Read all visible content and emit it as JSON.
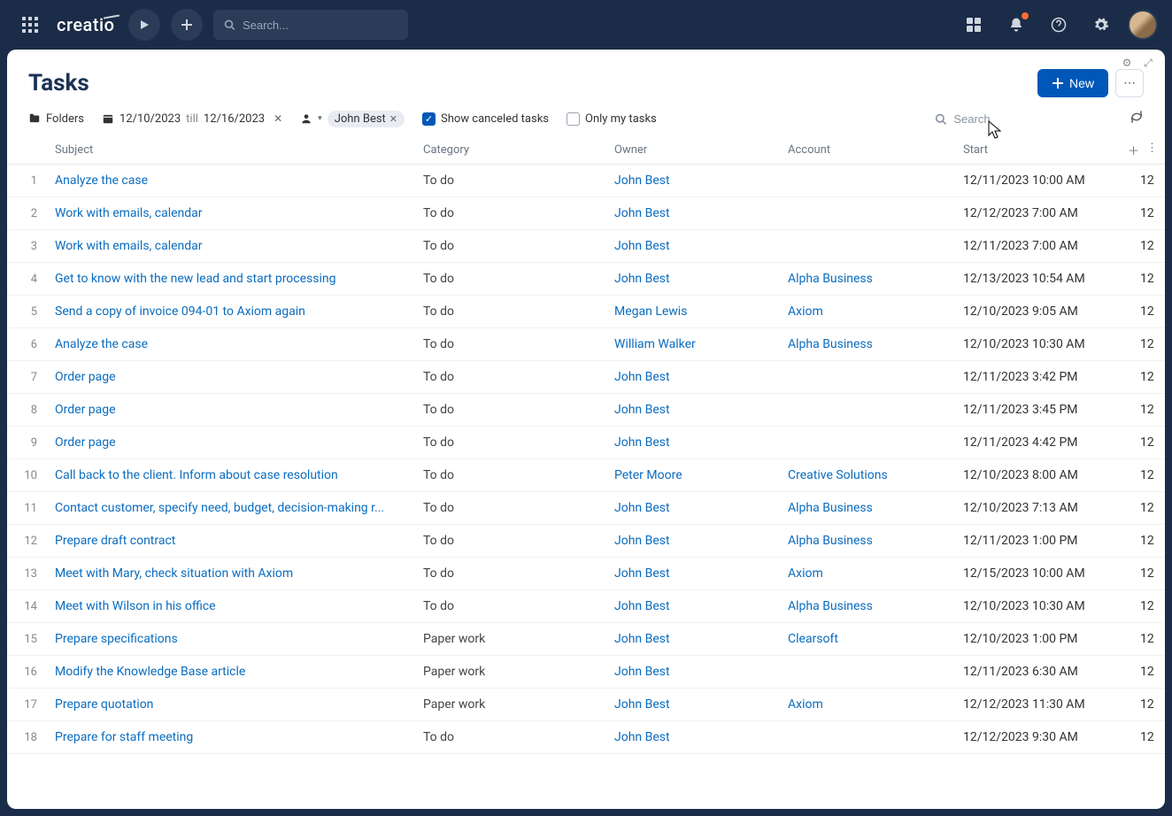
{
  "brand": "creatio",
  "global_search_placeholder": "Search...",
  "page_title": "Tasks",
  "new_button": "New",
  "filters": {
    "folders_label": "Folders",
    "date_from": "12/10/2023",
    "date_till_word": "till",
    "date_to": "12/16/2023",
    "owner_chip": "John Best",
    "show_canceled_label": "Show canceled tasks",
    "show_canceled_checked": true,
    "only_my_label": "Only my tasks",
    "only_my_checked": false,
    "search_placeholder": "Search"
  },
  "columns": {
    "subject": "Subject",
    "category": "Category",
    "owner": "Owner",
    "account": "Account",
    "start": "Start"
  },
  "rows": [
    {
      "n": "1",
      "subject": "Analyze the case",
      "category": "To do",
      "owner": "John Best",
      "account": "",
      "start": "12/11/2023 10:00 AM",
      "end": "12"
    },
    {
      "n": "2",
      "subject": "Work with emails, calendar",
      "category": "To do",
      "owner": "John Best",
      "account": "",
      "start": "12/12/2023 7:00 AM",
      "end": "12"
    },
    {
      "n": "3",
      "subject": "Work with emails, calendar",
      "category": "To do",
      "owner": "John Best",
      "account": "",
      "start": "12/11/2023 7:00 AM",
      "end": "12"
    },
    {
      "n": "4",
      "subject": "Get to know with the new lead and start processing",
      "category": "To do",
      "owner": "John Best",
      "account": "Alpha Business",
      "start": "12/13/2023 10:54 AM",
      "end": "12"
    },
    {
      "n": "5",
      "subject": "Send a copy of invoice 094-01 to Axiom again",
      "category": "To do",
      "owner": "Megan Lewis",
      "account": "Axiom",
      "start": "12/10/2023 9:05 AM",
      "end": "12"
    },
    {
      "n": "6",
      "subject": "Analyze the case",
      "category": "To do",
      "owner": "William Walker",
      "account": "Alpha Business",
      "start": "12/10/2023 10:30 AM",
      "end": "12"
    },
    {
      "n": "7",
      "subject": "Order page",
      "category": "To do",
      "owner": "John Best",
      "account": "",
      "start": "12/11/2023 3:42 PM",
      "end": "12"
    },
    {
      "n": "8",
      "subject": "Order page",
      "category": "To do",
      "owner": "John Best",
      "account": "",
      "start": "12/11/2023 3:45 PM",
      "end": "12"
    },
    {
      "n": "9",
      "subject": "Order page",
      "category": "To do",
      "owner": "John Best",
      "account": "",
      "start": "12/11/2023 4:42 PM",
      "end": "12"
    },
    {
      "n": "10",
      "subject": "Call back to the client. Inform about case resolution",
      "category": "To do",
      "owner": "Peter Moore",
      "account": "Creative Solutions",
      "start": "12/10/2023 8:00 AM",
      "end": "12"
    },
    {
      "n": "11",
      "subject": "Contact customer, specify need, budget, decision-making r...",
      "category": "To do",
      "owner": "John Best",
      "account": "Alpha Business",
      "start": "12/10/2023 7:13 AM",
      "end": "12"
    },
    {
      "n": "12",
      "subject": "Prepare draft contract",
      "category": "To do",
      "owner": "John Best",
      "account": "Alpha Business",
      "start": "12/11/2023 1:00 PM",
      "end": "12"
    },
    {
      "n": "13",
      "subject": "Meet with Mary, check situation with Axiom",
      "category": "To do",
      "owner": "John Best",
      "account": "Axiom",
      "start": "12/15/2023 10:00 AM",
      "end": "12"
    },
    {
      "n": "14",
      "subject": "Meet with Wilson in his office",
      "category": "To do",
      "owner": "John Best",
      "account": "Alpha Business",
      "start": "12/10/2023 10:30 AM",
      "end": "12"
    },
    {
      "n": "15",
      "subject": "Prepare specifications",
      "category": "Paper work",
      "owner": "John Best",
      "account": "Clearsoft",
      "start": "12/10/2023 1:00 PM",
      "end": "12"
    },
    {
      "n": "16",
      "subject": "Modify the Knowledge Base article",
      "category": "Paper work",
      "owner": "John Best",
      "account": "",
      "start": "12/11/2023 6:30 AM",
      "end": "12"
    },
    {
      "n": "17",
      "subject": "Prepare quotation",
      "category": "Paper work",
      "owner": "John Best",
      "account": "Axiom",
      "start": "12/12/2023 11:30 AM",
      "end": "12"
    },
    {
      "n": "18",
      "subject": "Prepare for staff meeting",
      "category": "To do",
      "owner": "John Best",
      "account": "",
      "start": "12/12/2023 9:30 AM",
      "end": "12"
    }
  ]
}
